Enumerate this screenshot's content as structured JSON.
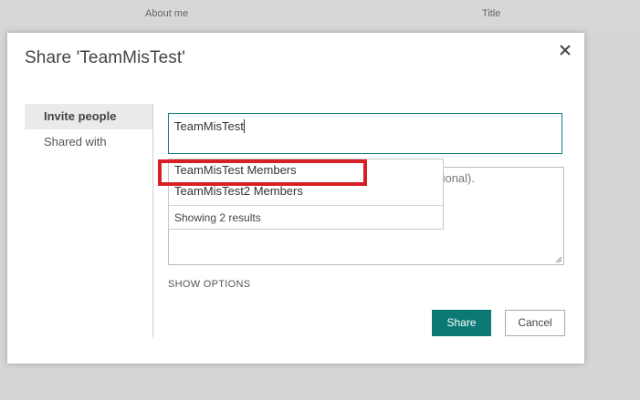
{
  "background": {
    "columns": [
      "About me",
      "Title"
    ]
  },
  "dialog": {
    "title": "Share 'TeamMisTest'",
    "close_icon": "close-icon"
  },
  "nav": {
    "items": [
      {
        "label": "Invite people",
        "active": true
      },
      {
        "label": "Shared with",
        "active": false
      }
    ]
  },
  "invite": {
    "value": "TeamMisTest"
  },
  "message": {
    "placeholder_visible": "ional)."
  },
  "suggestions": {
    "items": [
      "TeamMisTest Members",
      "TeamMisTest2 Members"
    ],
    "footer": "Showing 2 results"
  },
  "show_options": "SHOW OPTIONS",
  "buttons": {
    "share": "Share",
    "cancel": "Cancel"
  },
  "colors": {
    "accent": "#0b7a75",
    "highlight": "#d62026"
  }
}
